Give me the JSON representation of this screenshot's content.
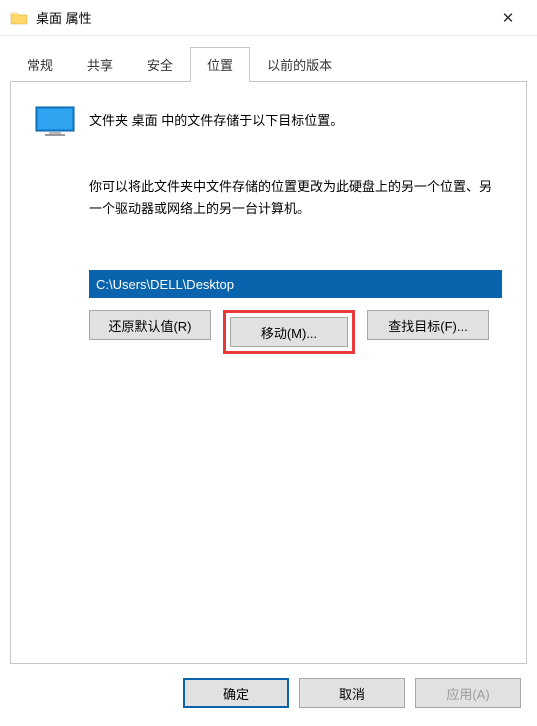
{
  "window": {
    "title": "桌面 属性"
  },
  "tabs": {
    "items": [
      {
        "label": "常规"
      },
      {
        "label": "共享"
      },
      {
        "label": "安全"
      },
      {
        "label": "位置"
      },
      {
        "label": "以前的版本"
      }
    ],
    "active_index": 3
  },
  "content": {
    "desc1": "文件夹 桌面 中的文件存储于以下目标位置。",
    "desc2": "你可以将此文件夹中文件存储的位置更改为此硬盘上的另一个位置、另一个驱动器或网络上的另一台计算机。",
    "path_value": "C:\\Users\\DELL\\Desktop",
    "buttons": {
      "restore": "还原默认值(R)",
      "move": "移动(M)...",
      "find": "查找目标(F)..."
    }
  },
  "footer": {
    "ok": "确定",
    "cancel": "取消",
    "apply": "应用(A)"
  }
}
